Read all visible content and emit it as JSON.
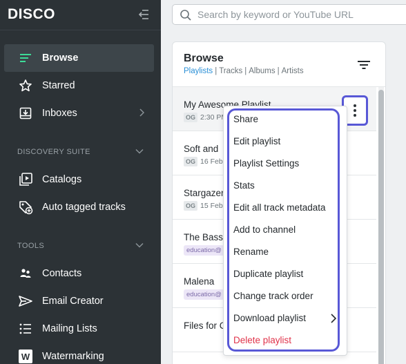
{
  "app": {
    "logo": "DISCO"
  },
  "sidebar": {
    "items": [
      {
        "label": "Browse"
      },
      {
        "label": "Starred"
      },
      {
        "label": "Inboxes"
      }
    ],
    "discovery_suite": {
      "heading": "DISCOVERY SUITE",
      "items": [
        {
          "label": "Catalogs"
        },
        {
          "label": "Auto tagged tracks"
        }
      ]
    },
    "tools": {
      "heading": "TOOLS",
      "items": [
        {
          "label": "Contacts"
        },
        {
          "label": "Email Creator"
        },
        {
          "label": "Mailing Lists"
        },
        {
          "label": "Watermarking"
        }
      ]
    },
    "colors": {
      "background": "#2c3236",
      "active": "#3d454a",
      "accent": "#3ddc97"
    }
  },
  "search": {
    "placeholder": "Search by keyword or YouTube URL",
    "value": ""
  },
  "browse": {
    "title": "Browse",
    "filters": [
      "Playlists",
      "Tracks",
      "Albums",
      "Artists"
    ],
    "active_filter": "Playlists",
    "rows": [
      {
        "title": "My Awesome Playlist",
        "tag": "OG",
        "date": "2:30 PM"
      },
      {
        "title": "Soft and",
        "tag": "OG",
        "date": "16 Feb"
      },
      {
        "title": "Stargazer",
        "tag": "OG",
        "date": "15 Feb"
      },
      {
        "title": "The Bass",
        "tag": "education@"
      },
      {
        "title": "Malena",
        "tag": "education@"
      },
      {
        "title": "Files for C"
      }
    ]
  },
  "context_menu": {
    "items": [
      {
        "label": "Share"
      },
      {
        "label": "Edit playlist"
      },
      {
        "label": "Playlist Settings"
      },
      {
        "label": "Stats"
      },
      {
        "label": "Edit all track metadata"
      },
      {
        "label": "Add to channel"
      },
      {
        "label": "Rename"
      },
      {
        "label": "Duplicate playlist"
      },
      {
        "label": "Change track order"
      },
      {
        "label": "Download playlist"
      },
      {
        "label": "Delete playlist"
      }
    ],
    "highlight_color": "#5858d6",
    "danger_color": "#e0334a"
  }
}
